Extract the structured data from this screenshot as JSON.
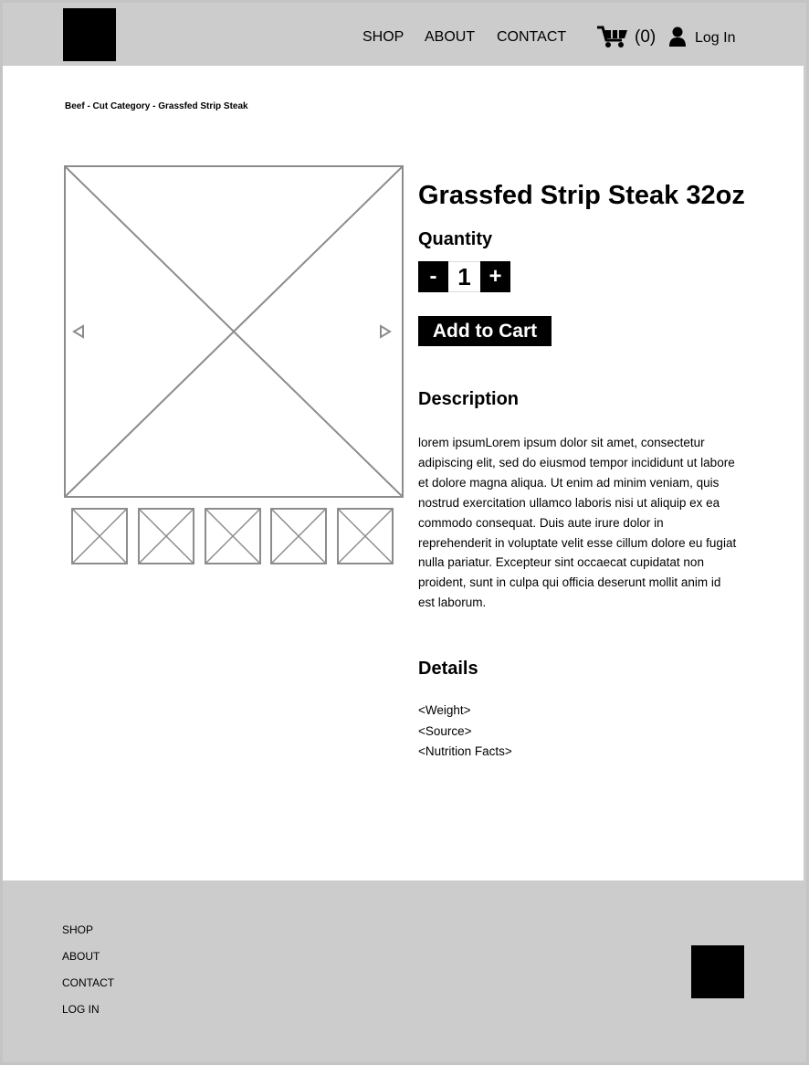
{
  "header": {
    "nav": [
      "SHOP",
      "ABOUT",
      "CONTACT"
    ],
    "cart_count": "(0)",
    "login_label": "Log In"
  },
  "breadcrumb": "Beef - Cut Category - Grassfed Strip Steak",
  "product": {
    "title": "Grassfed Strip Steak 32oz",
    "quantity_label": "Quantity",
    "minus_label": "-",
    "quantity_value": "1",
    "plus_label": "+",
    "add_to_cart_label": "Add to Cart",
    "description_heading": "Description",
    "description_text": "lorem ipsumLorem ipsum dolor sit amet, consectetur adipiscing elit, sed do eiusmod tempor incididunt ut labore et dolore magna aliqua. Ut enim ad minim veniam, quis nostrud exercitation ullamco laboris nisi ut aliquip ex ea commodo consequat. Duis aute irure dolor in reprehenderit in voluptate velit esse cillum dolore eu fugiat nulla pariatur. Excepteur sint occaecat cupidatat non proident, sunt in culpa qui officia deserunt mollit anim id est laborum.",
    "details_heading": "Details",
    "details_items": [
      "<Weight>",
      "<Source>",
      "<Nutrition Facts>"
    ]
  },
  "gallery": {
    "thumbnail_count": 5
  },
  "footer": {
    "links": [
      "SHOP",
      "ABOUT",
      "CONTACT",
      "LOG IN"
    ]
  },
  "icons": {
    "cart": "shopping-cart-icon",
    "user": "user-icon",
    "prev": "arrow-left-icon",
    "next": "arrow-right-icon"
  }
}
